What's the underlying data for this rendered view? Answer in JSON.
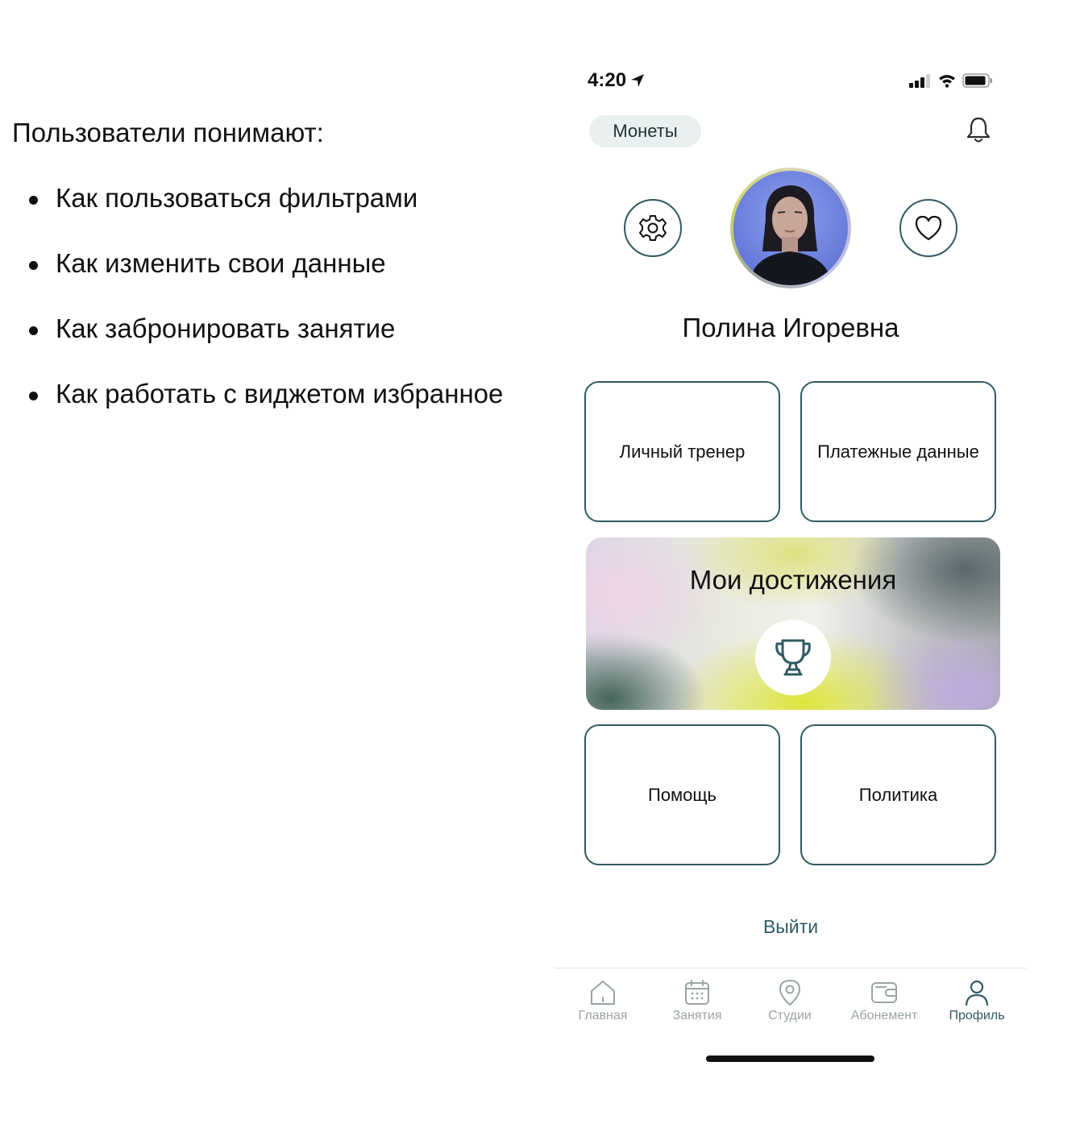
{
  "intro": {
    "heading": "Пользователи понимают:",
    "bullets": [
      "Как пользоваться фильтрами",
      "Как изменить свои данные",
      "Как забронировать занятие",
      "Как работать с виджетом избранное"
    ]
  },
  "status_bar": {
    "time": "4:20"
  },
  "header": {
    "coins_label": "Монеты"
  },
  "profile": {
    "name": "Полина Игоревна"
  },
  "tiles": {
    "trainer": "Личный тренер",
    "payment": "Платежные данные",
    "help": "Помощь",
    "policy": "Политика"
  },
  "achievements": {
    "title": "Мои достижения"
  },
  "logout_label": "Выйти",
  "tabbar": {
    "items": [
      {
        "label": "Главная",
        "icon": "home-icon"
      },
      {
        "label": "Занятия",
        "icon": "calendar-icon"
      },
      {
        "label": "Студии",
        "icon": "location-pin-icon"
      },
      {
        "label": "Абонемент",
        "icon": "wallet-icon"
      },
      {
        "label": "Профиль",
        "icon": "user-icon"
      }
    ],
    "active": "Профиль"
  },
  "colors": {
    "accent": "#2f5a62",
    "inactive_tab": "#9aa3a5",
    "pill_bg": "#eaf0ef"
  }
}
